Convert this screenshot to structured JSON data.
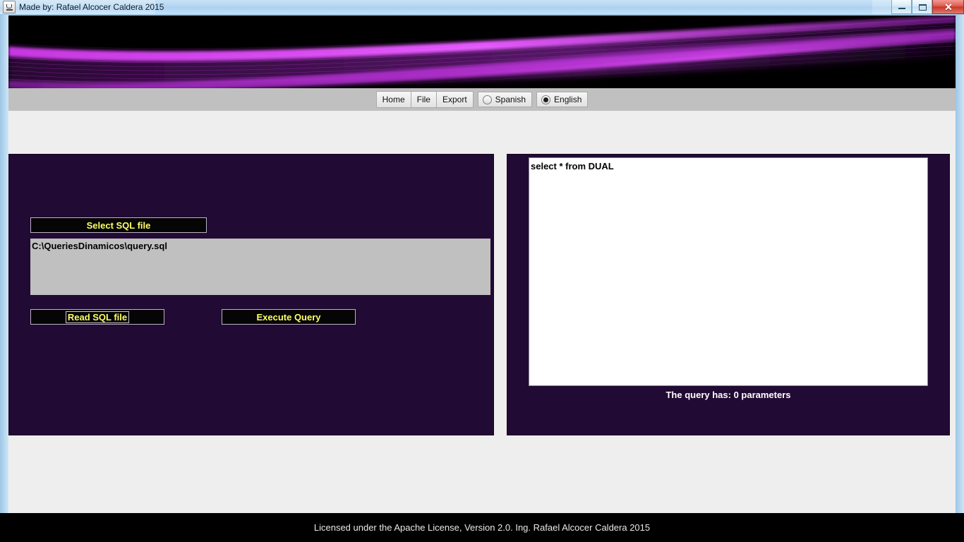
{
  "window": {
    "title": "Made by: Rafael Alcocer Caldera 2015",
    "icon": "java-coffee-cup-icon",
    "controls": {
      "minimize": "–",
      "maximize": "□",
      "close": "✕"
    }
  },
  "banner": {
    "name": "purple-light-streaks-banner",
    "background_color": "#000000",
    "accent_color": "#d13fe8"
  },
  "menu": {
    "buttons": [
      {
        "label": "Home",
        "name": "menu-button-home"
      },
      {
        "label": "File",
        "name": "menu-button-file"
      },
      {
        "label": "Export",
        "name": "menu-button-export"
      }
    ],
    "language_options": [
      {
        "label": "Spanish",
        "selected": false
      },
      {
        "label": "English",
        "selected": true
      }
    ]
  },
  "left_panel": {
    "select_button_label": "Select SQL file",
    "file_path": "C:\\QueriesDinamicos\\query.sql",
    "read_button_label": "Read SQL file",
    "execute_button_label": "Execute Query",
    "panel_color": "#210a33",
    "button_text_color": "#ffff66"
  },
  "right_panel": {
    "query_text": "select * from DUAL",
    "parameters_label": "The query has: 0 parameters",
    "panel_color": "#210a33"
  },
  "footer": {
    "text": "Licensed under the Apache License, Version 2.0. Ing. Rafael Alcocer Caldera 2015"
  }
}
